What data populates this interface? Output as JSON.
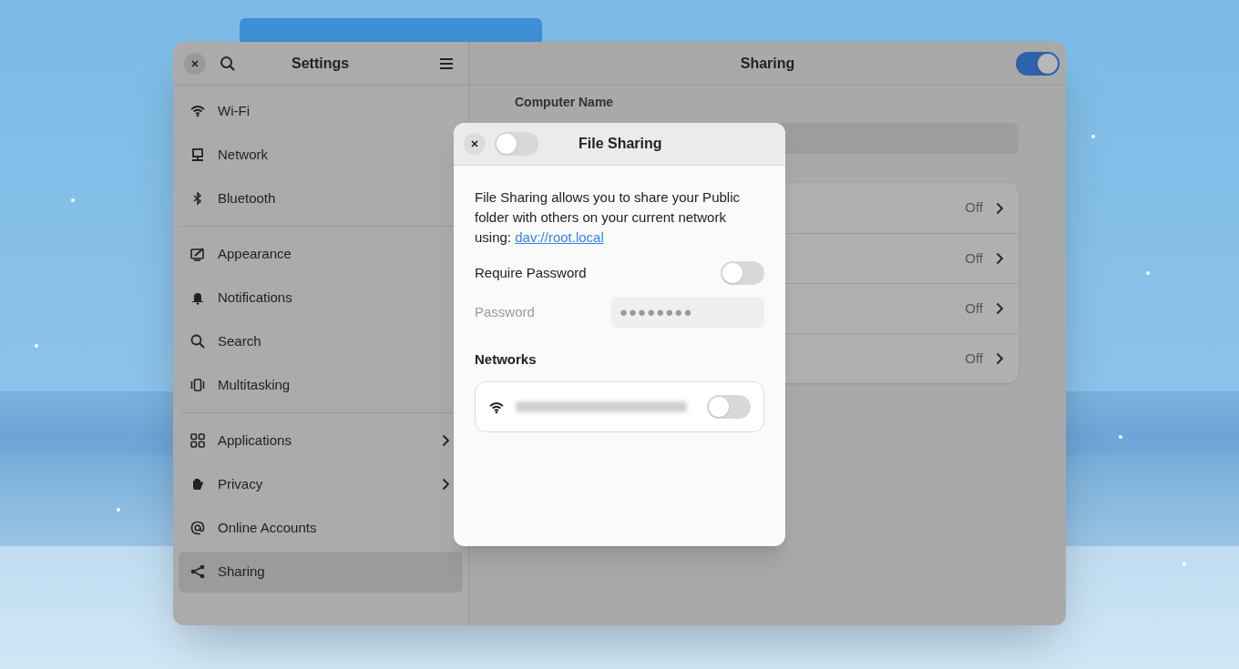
{
  "window": {
    "title": "Settings"
  },
  "sidebar": {
    "groups": [
      [
        {
          "label": "Wi-Fi",
          "kind": "wifi",
          "selected": false,
          "submenu": false
        },
        {
          "label": "Network",
          "kind": "network",
          "selected": false,
          "submenu": false
        },
        {
          "label": "Bluetooth",
          "kind": "bluetooth",
          "selected": false,
          "submenu": false
        }
      ],
      [
        {
          "label": "Appearance",
          "kind": "appearance",
          "selected": false,
          "submenu": false
        },
        {
          "label": "Notifications",
          "kind": "bell",
          "selected": false,
          "submenu": false
        },
        {
          "label": "Search",
          "kind": "search",
          "selected": false,
          "submenu": false
        },
        {
          "label": "Multitasking",
          "kind": "multitasking",
          "selected": false,
          "submenu": false
        }
      ],
      [
        {
          "label": "Applications",
          "kind": "grid",
          "selected": false,
          "submenu": true
        },
        {
          "label": "Privacy",
          "kind": "hand",
          "selected": false,
          "submenu": true
        },
        {
          "label": "Online Accounts",
          "kind": "at",
          "selected": false,
          "submenu": false
        },
        {
          "label": "Sharing",
          "kind": "share",
          "selected": true,
          "submenu": false
        }
      ]
    ]
  },
  "content": {
    "title": "Sharing",
    "enabled": true,
    "computer_name_label": "Computer Name",
    "rows": [
      {
        "value": "Off"
      },
      {
        "value": "Off"
      },
      {
        "value": "Off"
      },
      {
        "value": "Off"
      }
    ]
  },
  "dialog": {
    "title": "File Sharing",
    "enabled": false,
    "description": "File Sharing allows you to share your Public folder with others on your current network using:",
    "link": "dav://root.local",
    "require_password": {
      "label": "Require Password",
      "on": false
    },
    "password": {
      "label": "Password",
      "value": "●●●●●●●●",
      "disabled": true
    },
    "networks": {
      "heading": "Networks",
      "items": [
        {
          "on": false
        }
      ]
    }
  }
}
